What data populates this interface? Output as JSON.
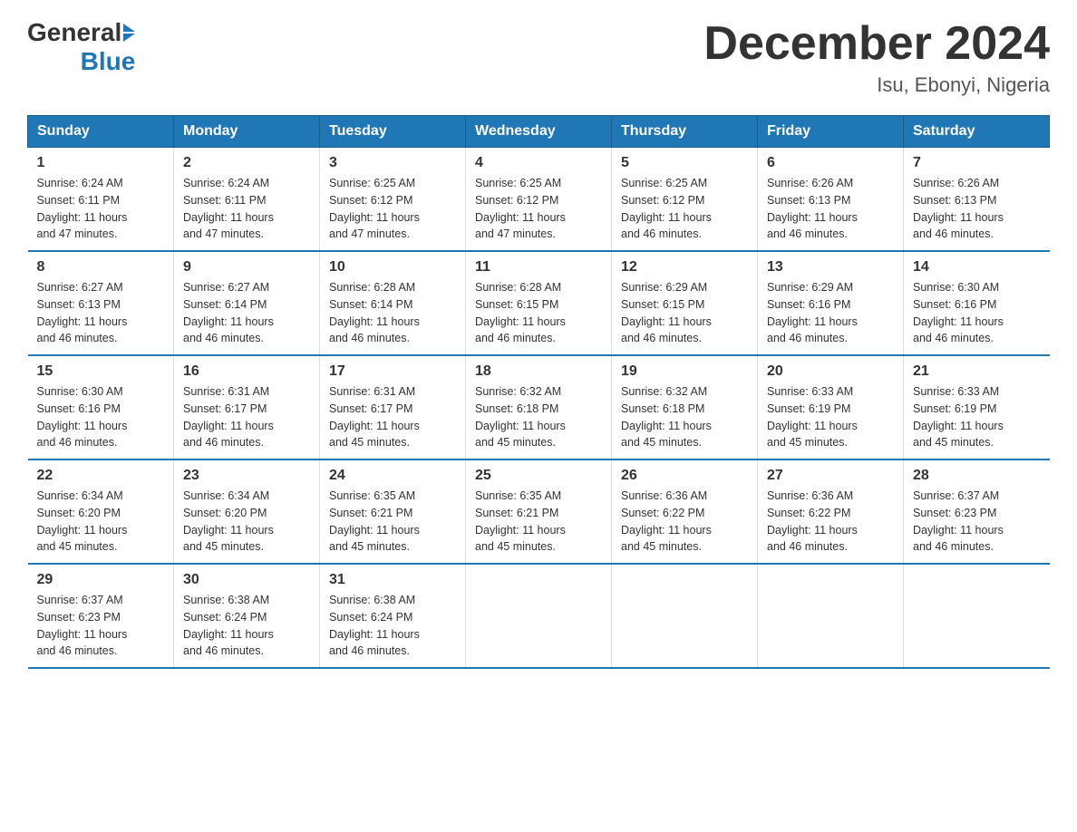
{
  "header": {
    "logo": {
      "text_general": "General",
      "text_blue": "Blue",
      "arrow_color": "#2077b5"
    },
    "title": "December 2024",
    "location": "Isu, Ebonyi, Nigeria"
  },
  "days_of_week": [
    "Sunday",
    "Monday",
    "Tuesday",
    "Wednesday",
    "Thursday",
    "Friday",
    "Saturday"
  ],
  "weeks": [
    [
      {
        "day": "1",
        "sunrise": "6:24 AM",
        "sunset": "6:11 PM",
        "daylight": "11 hours and 47 minutes."
      },
      {
        "day": "2",
        "sunrise": "6:24 AM",
        "sunset": "6:11 PM",
        "daylight": "11 hours and 47 minutes."
      },
      {
        "day": "3",
        "sunrise": "6:25 AM",
        "sunset": "6:12 PM",
        "daylight": "11 hours and 47 minutes."
      },
      {
        "day": "4",
        "sunrise": "6:25 AM",
        "sunset": "6:12 PM",
        "daylight": "11 hours and 47 minutes."
      },
      {
        "day": "5",
        "sunrise": "6:25 AM",
        "sunset": "6:12 PM",
        "daylight": "11 hours and 46 minutes."
      },
      {
        "day": "6",
        "sunrise": "6:26 AM",
        "sunset": "6:13 PM",
        "daylight": "11 hours and 46 minutes."
      },
      {
        "day": "7",
        "sunrise": "6:26 AM",
        "sunset": "6:13 PM",
        "daylight": "11 hours and 46 minutes."
      }
    ],
    [
      {
        "day": "8",
        "sunrise": "6:27 AM",
        "sunset": "6:13 PM",
        "daylight": "11 hours and 46 minutes."
      },
      {
        "day": "9",
        "sunrise": "6:27 AM",
        "sunset": "6:14 PM",
        "daylight": "11 hours and 46 minutes."
      },
      {
        "day": "10",
        "sunrise": "6:28 AM",
        "sunset": "6:14 PM",
        "daylight": "11 hours and 46 minutes."
      },
      {
        "day": "11",
        "sunrise": "6:28 AM",
        "sunset": "6:15 PM",
        "daylight": "11 hours and 46 minutes."
      },
      {
        "day": "12",
        "sunrise": "6:29 AM",
        "sunset": "6:15 PM",
        "daylight": "11 hours and 46 minutes."
      },
      {
        "day": "13",
        "sunrise": "6:29 AM",
        "sunset": "6:16 PM",
        "daylight": "11 hours and 46 minutes."
      },
      {
        "day": "14",
        "sunrise": "6:30 AM",
        "sunset": "6:16 PM",
        "daylight": "11 hours and 46 minutes."
      }
    ],
    [
      {
        "day": "15",
        "sunrise": "6:30 AM",
        "sunset": "6:16 PM",
        "daylight": "11 hours and 46 minutes."
      },
      {
        "day": "16",
        "sunrise": "6:31 AM",
        "sunset": "6:17 PM",
        "daylight": "11 hours and 46 minutes."
      },
      {
        "day": "17",
        "sunrise": "6:31 AM",
        "sunset": "6:17 PM",
        "daylight": "11 hours and 45 minutes."
      },
      {
        "day": "18",
        "sunrise": "6:32 AM",
        "sunset": "6:18 PM",
        "daylight": "11 hours and 45 minutes."
      },
      {
        "day": "19",
        "sunrise": "6:32 AM",
        "sunset": "6:18 PM",
        "daylight": "11 hours and 45 minutes."
      },
      {
        "day": "20",
        "sunrise": "6:33 AM",
        "sunset": "6:19 PM",
        "daylight": "11 hours and 45 minutes."
      },
      {
        "day": "21",
        "sunrise": "6:33 AM",
        "sunset": "6:19 PM",
        "daylight": "11 hours and 45 minutes."
      }
    ],
    [
      {
        "day": "22",
        "sunrise": "6:34 AM",
        "sunset": "6:20 PM",
        "daylight": "11 hours and 45 minutes."
      },
      {
        "day": "23",
        "sunrise": "6:34 AM",
        "sunset": "6:20 PM",
        "daylight": "11 hours and 45 minutes."
      },
      {
        "day": "24",
        "sunrise": "6:35 AM",
        "sunset": "6:21 PM",
        "daylight": "11 hours and 45 minutes."
      },
      {
        "day": "25",
        "sunrise": "6:35 AM",
        "sunset": "6:21 PM",
        "daylight": "11 hours and 45 minutes."
      },
      {
        "day": "26",
        "sunrise": "6:36 AM",
        "sunset": "6:22 PM",
        "daylight": "11 hours and 45 minutes."
      },
      {
        "day": "27",
        "sunrise": "6:36 AM",
        "sunset": "6:22 PM",
        "daylight": "11 hours and 46 minutes."
      },
      {
        "day": "28",
        "sunrise": "6:37 AM",
        "sunset": "6:23 PM",
        "daylight": "11 hours and 46 minutes."
      }
    ],
    [
      {
        "day": "29",
        "sunrise": "6:37 AM",
        "sunset": "6:23 PM",
        "daylight": "11 hours and 46 minutes."
      },
      {
        "day": "30",
        "sunrise": "6:38 AM",
        "sunset": "6:24 PM",
        "daylight": "11 hours and 46 minutes."
      },
      {
        "day": "31",
        "sunrise": "6:38 AM",
        "sunset": "6:24 PM",
        "daylight": "11 hours and 46 minutes."
      },
      null,
      null,
      null,
      null
    ]
  ],
  "labels": {
    "sunrise": "Sunrise:",
    "sunset": "Sunset:",
    "daylight": "Daylight:"
  }
}
